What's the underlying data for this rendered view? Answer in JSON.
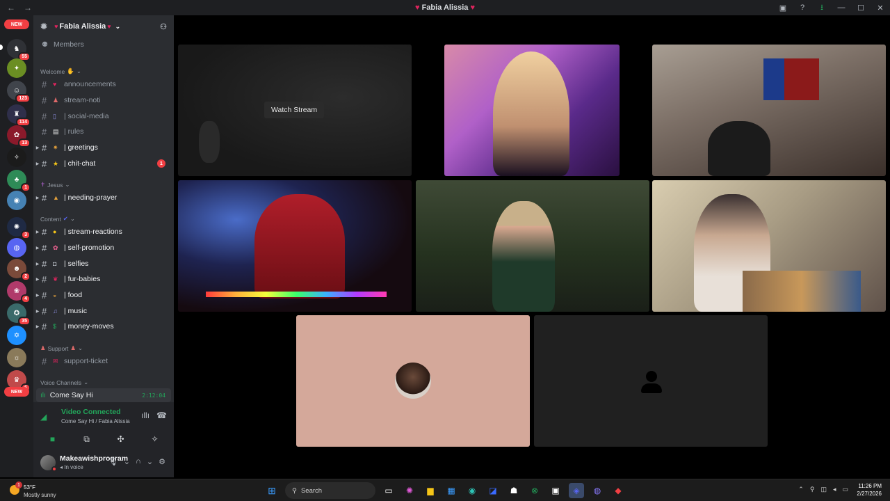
{
  "window": {
    "title": "Fabia Alissia",
    "nav_back": "←",
    "nav_forward": "→"
  },
  "rail": {
    "new_label": "NEW",
    "badges": [
      "55",
      "123",
      "114",
      "13",
      "1",
      "3",
      "2",
      "4",
      "35",
      "6"
    ]
  },
  "guild": {
    "name": "Fabia Alissia",
    "members_label": "Members"
  },
  "categories": {
    "welcome": "Welcome",
    "jesus": "Jesus",
    "content": "Content",
    "support": "Support",
    "voice": "Voice Channels"
  },
  "channels": [
    {
      "name": "announcements"
    },
    {
      "name": "stream-noti"
    },
    {
      "name": "| social-media"
    },
    {
      "name": "| rules"
    },
    {
      "name": "| greetings"
    },
    {
      "name": "| chit-chat",
      "mentions": "1"
    },
    {
      "name": "| needing-prayer"
    },
    {
      "name": "| stream-reactions"
    },
    {
      "name": "| self-promotion"
    },
    {
      "name": "| selfies"
    },
    {
      "name": "| fur-babies"
    },
    {
      "name": "| food"
    },
    {
      "name": "| music"
    },
    {
      "name": "| money-moves"
    },
    {
      "name": "support-ticket"
    }
  ],
  "voice_channel": {
    "name": "Come Say Hi",
    "timer": "2:12:04"
  },
  "voice_panel": {
    "status": "Video Connected",
    "subtitle": "Come Say Hi / Fabia Alissia"
  },
  "user": {
    "name": "Makeawishprogram",
    "status": "In voice"
  },
  "stage": {
    "watch_stream_label": "Watch Stream"
  },
  "taskbar": {
    "weather_badge": "1",
    "temperature": "53°F",
    "condition": "Mostly sunny",
    "search_placeholder": "Search",
    "time": "11:26 PM",
    "date": "2/27/2026"
  },
  "colors": {
    "accent_green": "#23a55a",
    "alert_red": "#f23f43",
    "sidebar_bg": "#2b2d31",
    "rail_bg": "#1e1f22"
  }
}
